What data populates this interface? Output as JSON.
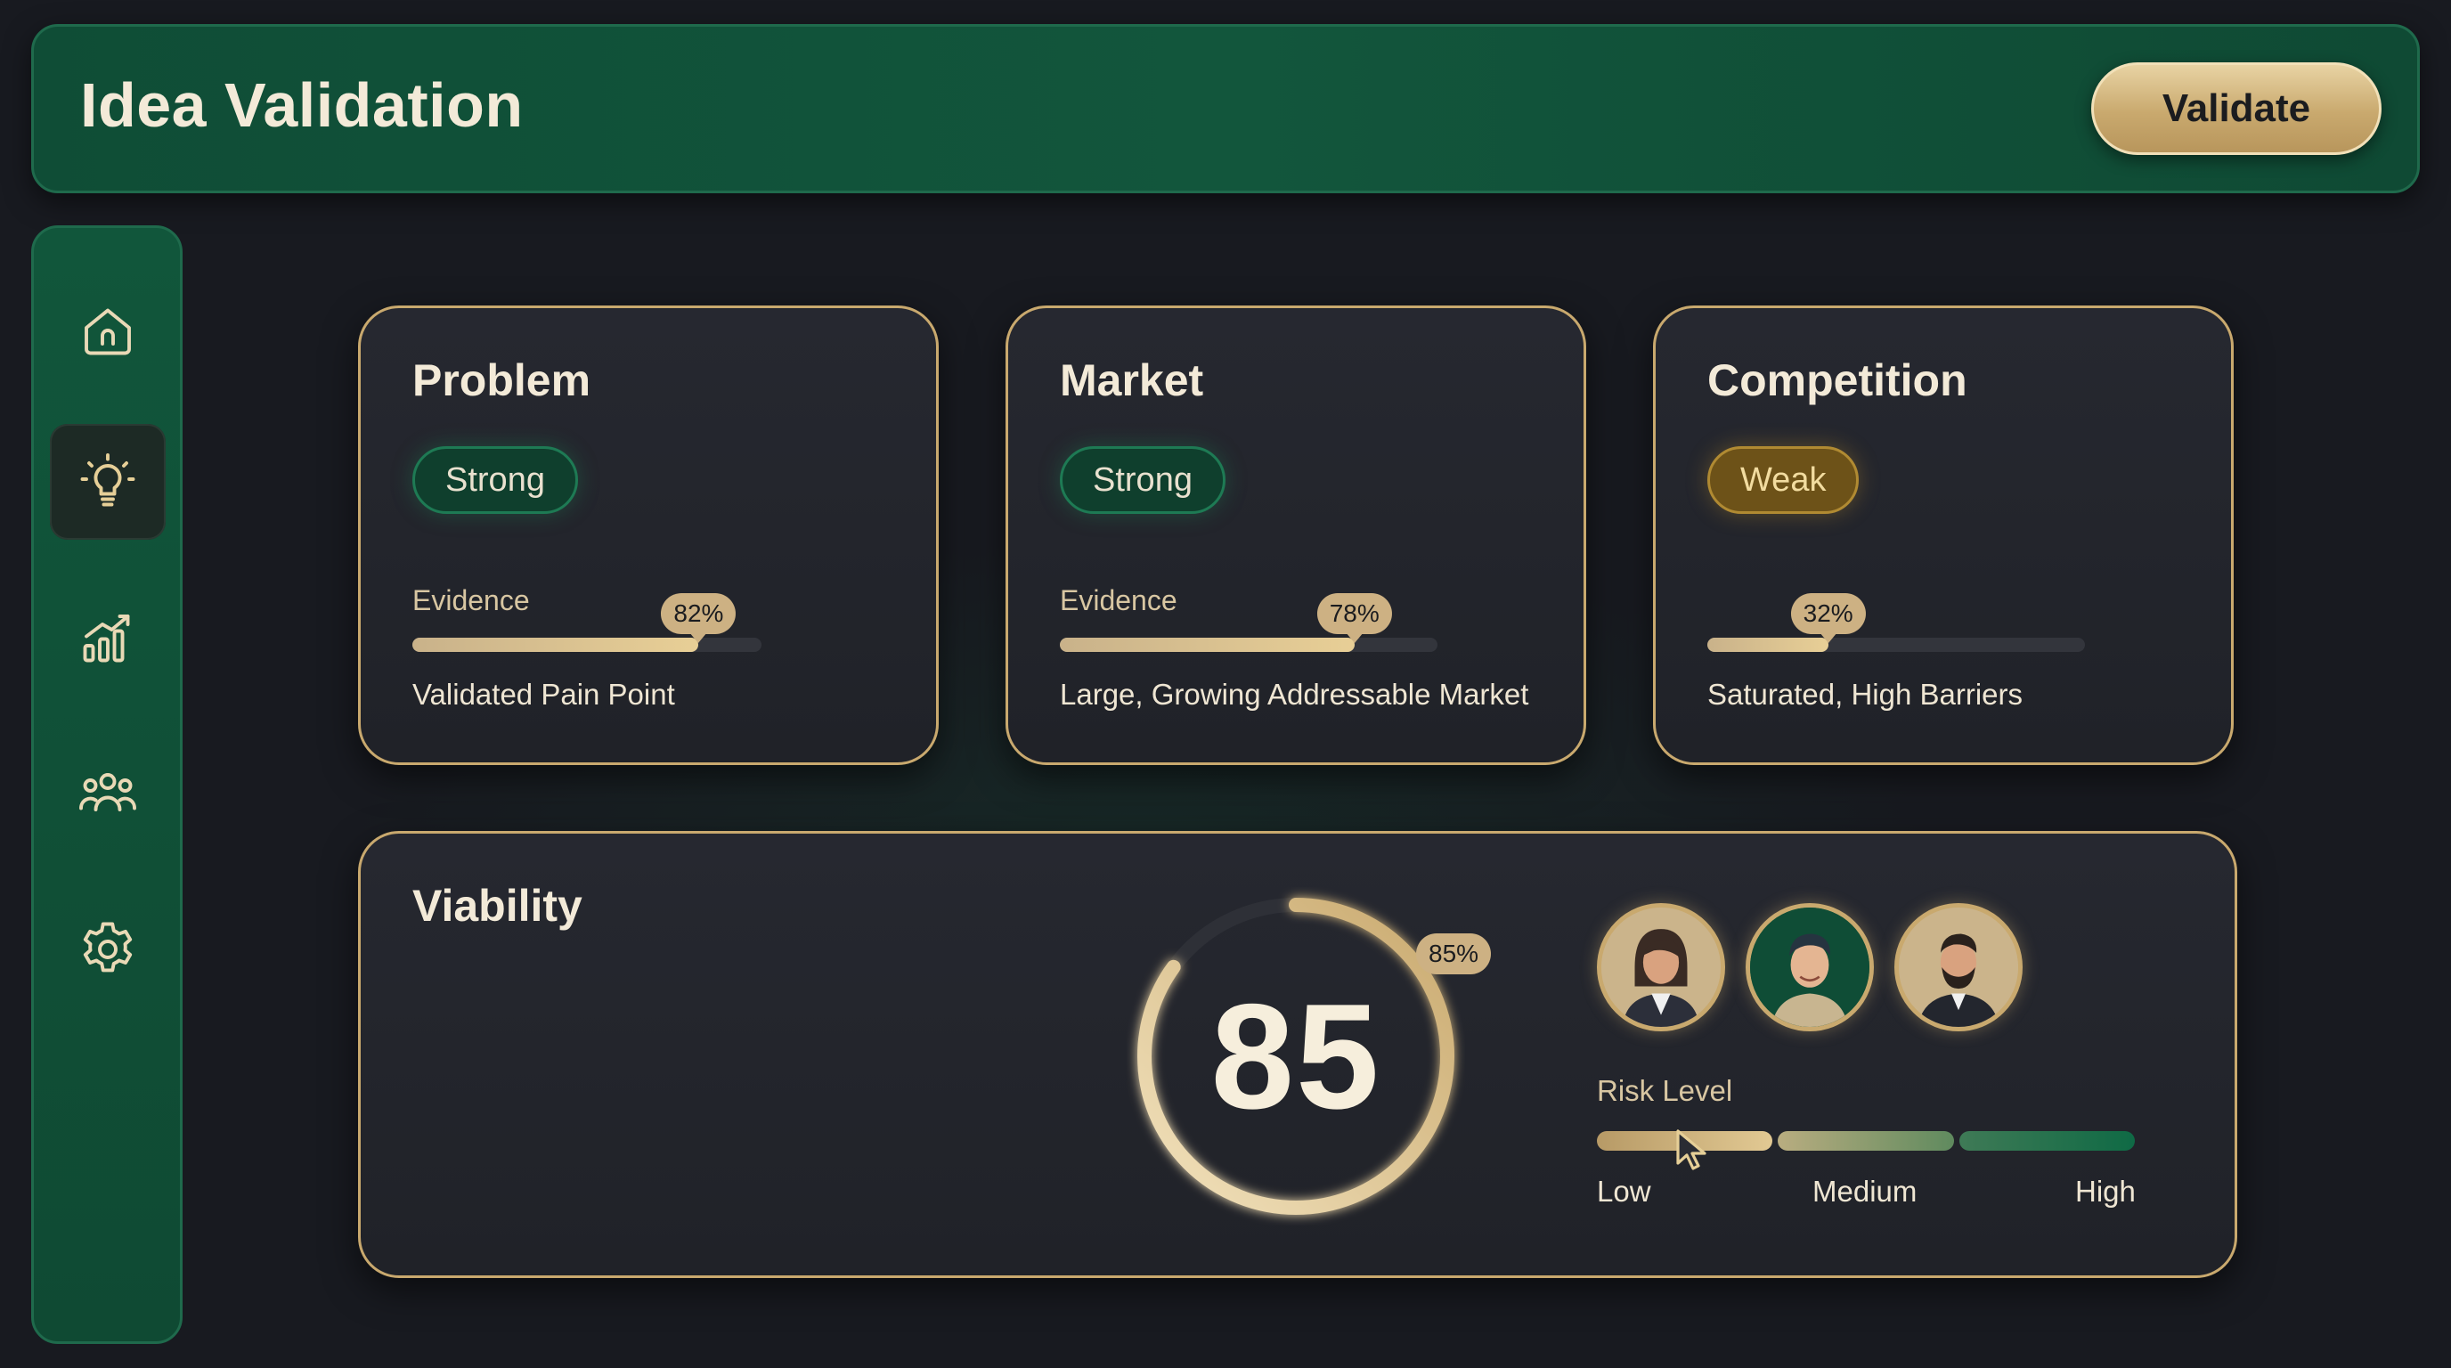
{
  "header": {
    "title": "Idea Validation",
    "validate_label": "Validate"
  },
  "sidebar": {
    "items": [
      {
        "name": "home",
        "icon": "home-icon",
        "active": false
      },
      {
        "name": "ideas",
        "icon": "lightbulb-icon",
        "active": true
      },
      {
        "name": "analytics",
        "icon": "chart-icon",
        "active": false
      },
      {
        "name": "team",
        "icon": "users-icon",
        "active": false
      },
      {
        "name": "settings",
        "icon": "gear-icon",
        "active": false
      }
    ]
  },
  "cards": [
    {
      "title": "Problem",
      "badge": "Strong",
      "evidence_label": "Evidence",
      "evidence_pct": "82%",
      "evidence_value": 0.82,
      "description": "Validated Pain Point"
    },
    {
      "title": "Market",
      "badge": "Strong",
      "evidence_label": "Evidence",
      "evidence_pct": "78%",
      "evidence_value": 0.78,
      "description": "Large, Growing Addressable Market"
    },
    {
      "title": "Competition",
      "badge": "Weak",
      "evidence_label": "",
      "evidence_pct": "32%",
      "evidence_value": 0.32,
      "description": "Saturated, High Barriers"
    }
  ],
  "viability": {
    "title": "Viability",
    "score": "85",
    "score_pct": "85%",
    "score_value": 0.85,
    "risk_label": "Risk Level",
    "risk_levels": [
      "Low",
      "Medium",
      "High"
    ]
  },
  "colors": {
    "background": "#181a20",
    "brand_green": "#12563c",
    "accent_gold": "#c9a96e",
    "strong_badge": "#0f3f2d",
    "weak_badge": "#6d5218"
  }
}
